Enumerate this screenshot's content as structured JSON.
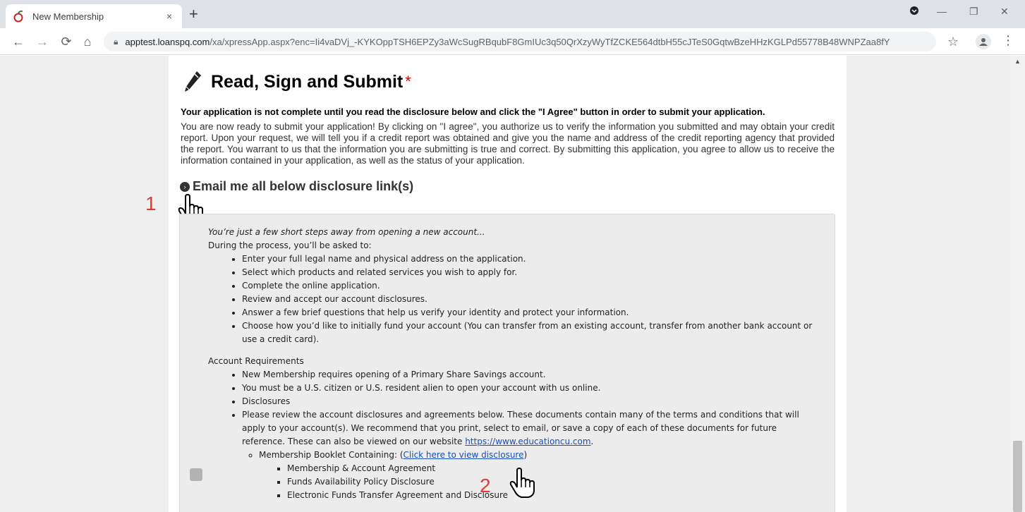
{
  "browser": {
    "tab_title": "New Membership",
    "tab_close": "×",
    "new_tab": "+",
    "url_host": "apptest.loanspq.com",
    "url_path": "/xa/xpressApp.aspx?enc=Ii4vaDVj_-KYKOppTSH6EPZy3aWcSugRBqubF8GmIUc3q50QrXzyWyTfZCKE564dtbH55cJTeS0GqtwBzeHHzKGLPd55778B48WNPZaa8fY"
  },
  "page": {
    "title": "Read, Sign and Submit",
    "required_mark": "*",
    "notice": "Your application is not complete until you read the disclosure below and click the \"I Agree\" button in order to submit your application.",
    "intro": "You are now ready to submit your application! By clicking on \"I agree\", you authorize us to verify the information you submitted and may obtain your credit report. Upon your request, we will tell you if a credit report was obtained and give you the name and address of the credit reporting agency that provided the report. You warrant to us that the information you are submitting is true and correct. By submitting this application, you agree to allow us to receive the information contained in your application, as well as the status of your application.",
    "email_link": "Email me all below disclosure link(s)"
  },
  "annotations": {
    "step1": "1",
    "step2": "2"
  },
  "disclosure": {
    "lead": "You’re just a few short steps away from opening a new account...",
    "process_intro": "During the process, you’ll be asked to:",
    "process_steps": [
      "Enter your full legal name and physical address on the application.",
      "Select which products and related services you wish to apply for.",
      "Complete the online application.",
      "Review and accept our account disclosures.",
      "Answer a few brief questions that help us verify your identity and protect your information.",
      "Choose how you’d like to initially fund your account (You can transfer from an existing account, transfer from another bank account or use a credit card)."
    ],
    "requirements_title": "Account Requirements",
    "requirements": [
      "New Membership requires opening of a Primary Share Savings account.",
      "You must be a U.S. citizen or U.S. resident alien to open your account with us online.",
      "Disclosures"
    ],
    "review_text": "Please review the account disclosures and agreements below. These documents contain many of the terms and conditions that will apply to your account(s). We recommend that you print, select to email, or save a copy of each of these documents for future reference. These can also be viewed on our website ",
    "website_link": "https://www.educationcu.com",
    "review_end": ".",
    "booklet_label": "Membership Booklet Containing: (",
    "booklet_link": "Click here to view disclosure",
    "booklet_end": ")",
    "booklet_items": [
      "Membership & Account Agreement",
      "Funds Availability Policy Disclosure",
      "Electronic Funds Transfer Agreement and Disclosure"
    ]
  }
}
